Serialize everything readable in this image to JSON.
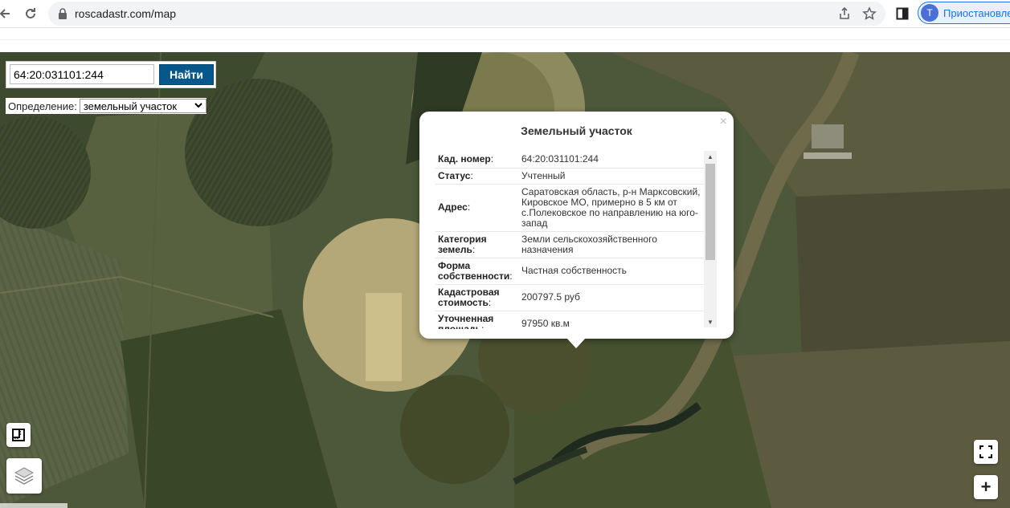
{
  "browser": {
    "url": "roscadastr.com/map",
    "profile_initial": "T",
    "profile_label": "Приостановлено"
  },
  "search": {
    "query": "64:20:031101:244",
    "find_label": "Найти",
    "definition_label": "Определение:",
    "definition_value": "земельный участок"
  },
  "popup": {
    "title": "Земельный участок",
    "close": "×",
    "rows": [
      {
        "key": "Кад. номер",
        "value": "64:20:031101:244"
      },
      {
        "key": "Статус",
        "value": "Учтенный"
      },
      {
        "key": "Адрес",
        "value": "Саратовская область, р-н Марксовский, Кировское МО, примерно в 5 км от с.Полековское по направлению на юго-запад"
      },
      {
        "key": "Категория земель",
        "value": "Земли сельскохозяйственного назначения"
      },
      {
        "key": "Форма собственности",
        "value": "Частная собственность"
      },
      {
        "key": "Кадастровая стоимость",
        "value": "200797.5 руб"
      },
      {
        "key": "Уточненная площадь",
        "value": "97950 кв.м"
      }
    ]
  },
  "controls": {
    "zoom_in": "+"
  },
  "icons": {
    "back": "arrow-left-icon",
    "reload": "reload-icon",
    "lock": "lock-icon",
    "share": "share-icon",
    "star": "star-icon",
    "side_panel": "side-panel-icon",
    "ruler": "ruler-icon",
    "layers": "layers-icon",
    "fullscreen": "fullscreen-icon"
  },
  "colors": {
    "find_button": "#06588c",
    "profile_accent": "#1a73e8"
  }
}
